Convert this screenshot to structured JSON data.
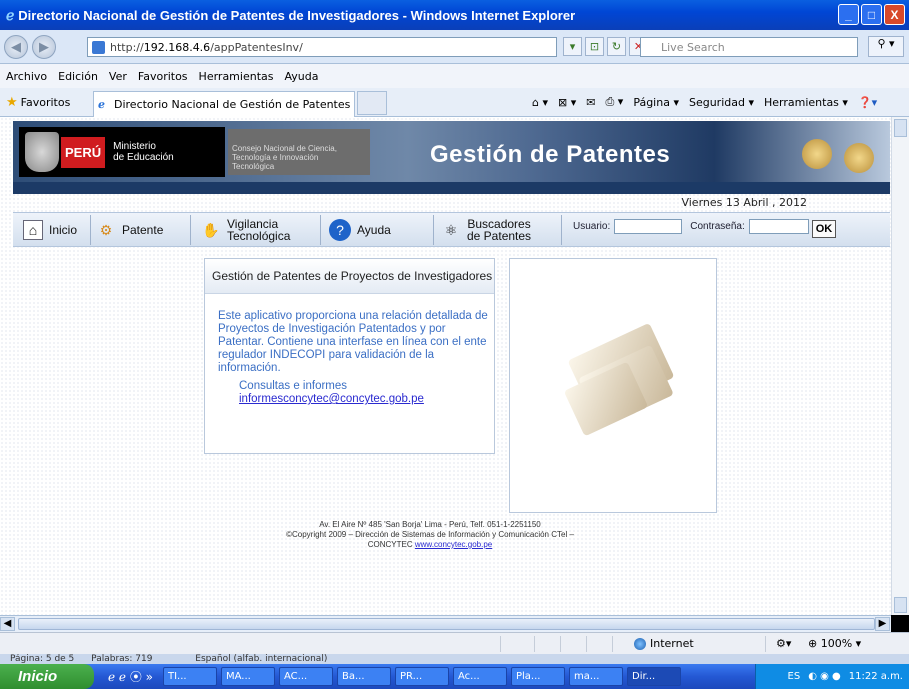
{
  "window": {
    "title": "Directorio Nacional de Gestión de Patentes de Investigadores - Windows Internet Explorer",
    "buttons": [
      "_",
      "□",
      "X"
    ]
  },
  "address": {
    "url_prefix": "http://",
    "url_host": "192.168.4.6",
    "url_path": "/appPatentesInv/",
    "search_placeholder": "Live Search"
  },
  "menu": [
    "Archivo",
    "Edición",
    "Ver",
    "Favoritos",
    "Herramientas",
    "Ayuda"
  ],
  "favbar": {
    "favorites_label": "Favoritos",
    "tab_title": "Directorio Nacional de Gestión de Patentes de Investi...",
    "tools": [
      "Página ▾",
      "Seguridad ▾",
      "Herramientas ▾"
    ]
  },
  "banner": {
    "peru": "PERÚ",
    "ministerio_line1": "Ministerio",
    "ministerio_line2": "de Educación",
    "concytec_line1": "Consejo Nacional de Ciencia,",
    "concytec_line2": "Tecnología e Innovación",
    "concytec_line3": "Tecnológica",
    "title": "Gestión de Patentes"
  },
  "date": "Viernes 13 Abril , 2012",
  "nav": {
    "inicio": "Inicio",
    "patente": "Patente",
    "vigilancia_1": "Vigilancia",
    "vigilancia_2": "Tecnológica",
    "ayuda": "Ayuda",
    "buscadores_1": "Buscadores",
    "buscadores_2": "de Patentes",
    "usuario_label": "Usuario:",
    "usuario_value": "",
    "password_label": "Contraseña:",
    "password_value": "",
    "ok": "OK"
  },
  "info": {
    "heading": "Gestión de Patentes de Proyectos de Investigadores",
    "body": "Este aplicativo proporciona una relación detallada de Proyectos de Investigación Patentados y por Patentar. Contiene una interfase en línea con el ente regulador INDECOPI para validación de la información.",
    "consult_label": "Consultas e informes",
    "consult_email": "informesconcytec@concytec.gob.pe"
  },
  "footer": {
    "line1": "Av. El Aire Nº 485 'San Borja' Lima - Perú, Telf. 051-1-2251150",
    "line2": "©Copyright 2009 – Dirección de Sistemas de Información y Comunicación CTel –",
    "line3": "CONCYTEC",
    "link": "www.concytec.gob.pe"
  },
  "status": {
    "zone": "Internet",
    "zoom": "100%"
  },
  "word_status": {
    "page": "Página: 5 de 5",
    "words": "Palabras: 719",
    "language": "Español (alfab. internacional)"
  },
  "taskbar": {
    "start": "Inicio",
    "buttons": [
      "TI...",
      "MA...",
      "AC...",
      "Ba...",
      "PR...",
      "Ac...",
      "Pla...",
      "ma...",
      "Dir..."
    ],
    "lang": "ES",
    "time": "11:22 a.m."
  },
  "colors": {
    "titlebar": "#0046d5",
    "banner_dark": "#1c3a66",
    "link_blue": "#3b6fc4",
    "peru_red": "#d01c1f"
  }
}
